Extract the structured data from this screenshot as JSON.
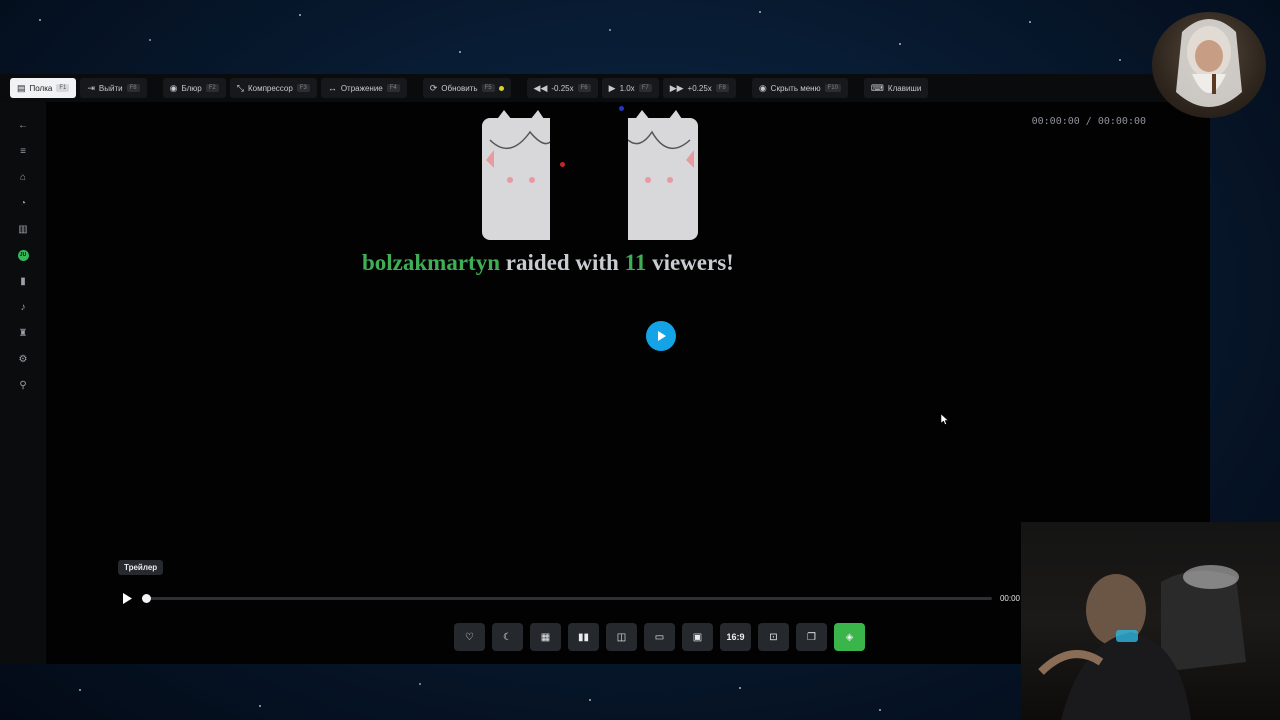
{
  "toolbar": {
    "items": [
      {
        "label": "Полка",
        "key": "F1"
      },
      {
        "label": "Выйти",
        "key": "F8"
      },
      {
        "label": "Блюр",
        "key": "F2"
      },
      {
        "label": "Компрессор",
        "key": "F3"
      },
      {
        "label": "Отражение",
        "key": "F4"
      },
      {
        "label": "Обновить",
        "key": "F5"
      },
      {
        "label": "-0.25x",
        "key": "F6"
      },
      {
        "label": "1.0x",
        "key": "F7"
      },
      {
        "label": "+0.25x",
        "key": "F8"
      },
      {
        "label": "Скрыть меню",
        "key": "F10"
      },
      {
        "label": "Клавиши"
      }
    ],
    "active_index": 0
  },
  "sidebar": {
    "icons": [
      "back-arrow-icon",
      "menu-icon",
      "home-icon",
      "history-icon",
      "book-icon",
      "user-badge-icon",
      "bookmark-icon",
      "bell-icon",
      "trophy-icon",
      "gear-icon",
      "search-icon"
    ],
    "badge_text": "JU"
  },
  "video": {
    "timecode": "00:00:00 / 00:00:00",
    "raid": {
      "user": "bolzakmartyn",
      "middle": "raided with",
      "count": "11",
      "suffix": "viewers!"
    },
    "tag": "Трейлер",
    "current_time": "00:00",
    "progress": 0
  },
  "controls": {
    "aspect_label": "16:9",
    "icons": [
      "heart-icon",
      "moon-icon",
      "grid-icon",
      "audio-wave-icon",
      "mirror-icon",
      "picture-icon",
      "pip-icon",
      "aspect-ratio",
      "screenshot-icon",
      "copy-icon",
      "layers-icon"
    ]
  },
  "colors": {
    "accent_green": "#3ab54a",
    "play_blue": "#13a3e6",
    "raid_green": "#3fae55"
  }
}
